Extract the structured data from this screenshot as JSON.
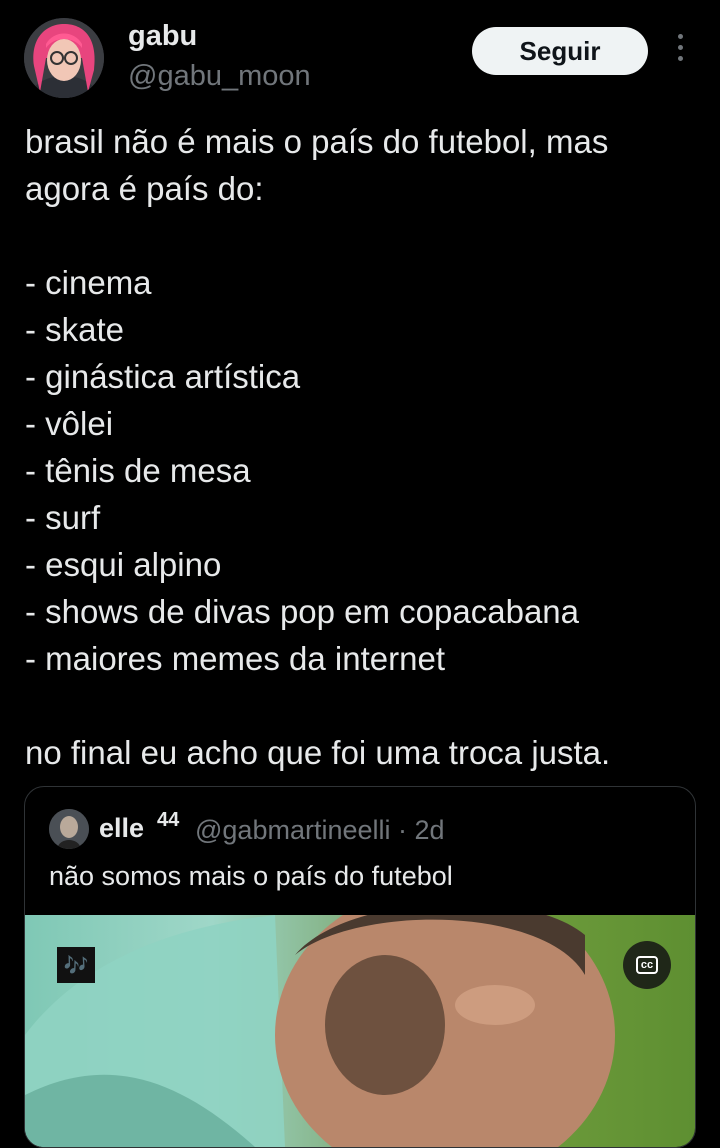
{
  "author": {
    "name": "gabu",
    "handle": "@gabu_moon",
    "follow_label": "Seguir"
  },
  "tweet": {
    "intro_lines": [
      "brasil não é mais o país do futebol, mas",
      "agora é país do:"
    ],
    "list": [
      "- cinema",
      "- skate",
      "- ginástica artística",
      "- vôlei",
      "- tênis de mesa",
      "- surf",
      "- esqui alpino",
      "- shows de divas pop em copacabana",
      "- maiores memes da internet"
    ],
    "closing": "no final eu acho que foi uma troca justa."
  },
  "quoted": {
    "name": "elle",
    "name_sup": "44",
    "handle_time": "@gabmartineelli · 2d",
    "text": "não somos mais o país do futebol",
    "music_badge": "🎶",
    "cc_label": "cc"
  },
  "icons": [
    "more-options-icon",
    "music-notes-icon",
    "closed-captions-icon"
  ]
}
